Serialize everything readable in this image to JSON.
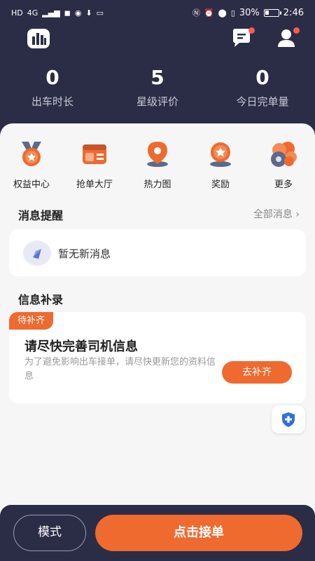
{
  "statusbar": {
    "left_icons": [
      "HD",
      "4G",
      "signal",
      "app",
      "app",
      "download",
      "app"
    ],
    "battery": "30%",
    "time": "2:46"
  },
  "header": {
    "logo_icon": "bar-chart-icon",
    "message_icon": "message-icon",
    "user_icon": "user-icon",
    "badge_color": "#ff5a4a",
    "stats": [
      {
        "value": "0",
        "label": "出车时长"
      },
      {
        "value": "5",
        "label": "星级评价"
      },
      {
        "value": "0",
        "label": "今日完单量"
      }
    ]
  },
  "quick_actions": [
    {
      "label": "权益中心",
      "icon": "medal-icon"
    },
    {
      "label": "抢单大厅",
      "icon": "ticket-icon"
    },
    {
      "label": "热力图",
      "icon": "map-pin-icon"
    },
    {
      "label": "奖励",
      "icon": "reward-icon"
    },
    {
      "label": "更多",
      "icon": "more-icon"
    }
  ],
  "messages": {
    "title": "消息提醒",
    "all_link": "全部消息 ›",
    "empty_text": "暂无新消息"
  },
  "info": {
    "title": "信息补录",
    "tag": "待补齐",
    "card_title": "请尽快完善司机信息",
    "card_desc": "为了避免影响出车接单，请尽快更新您的资料信息",
    "button": "去补齐"
  },
  "bottom": {
    "mode_label": "模式",
    "take_order_label": "点击接单"
  },
  "colors": {
    "header_bg": "#2b2c46",
    "accent": "#ee6a2f"
  }
}
